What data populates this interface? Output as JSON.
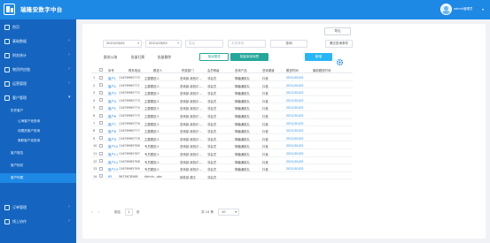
{
  "header": {
    "title": "瑞隆安数字中台",
    "username": "admin管理员",
    "brand_color": "#1e88e5",
    "avatar_icon": "user-avatar-icon",
    "caret_glyph": "▾"
  },
  "sidebar": {
    "background": "#1565c0",
    "items": [
      {
        "label": "首页",
        "icon": "home-icon"
      },
      {
        "label": "基础数据",
        "icon": "database-icon"
      },
      {
        "label": "财务统计",
        "icon": "finance-icon"
      },
      {
        "label": "物资供应链",
        "icon": "supply-chain-icon"
      },
      {
        "label": "运营管理",
        "icon": "operations-icon"
      },
      {
        "label": "客户管理",
        "icon": "customer-icon"
      }
    ],
    "sub_header": "历史客户",
    "sub_items": [
      {
        "label": "公海客户池查询"
      },
      {
        "label": "待跟进客户查询"
      },
      {
        "label": "离职客户池查询"
      }
    ],
    "more_items": [
      {
        "label": "客户报告"
      },
      {
        "label": "客户回访"
      },
      {
        "label": "客户列表",
        "active": true
      }
    ],
    "bottom_items": [
      {
        "label": "订单管理",
        "icon": "cart-icon"
      },
      {
        "label": "线上协作",
        "icon": "collab-icon"
      }
    ],
    "arrow_glyph": "›"
  },
  "toolbar": {
    "export_label": "导出",
    "date_from": "2021/03/02",
    "date_to": "2021/03/03",
    "name_placeholder": "姓名",
    "phone_placeholder": "手机号码",
    "query_label": "查询",
    "clear_label": "清空查询条件",
    "range_separator": "-",
    "caret_glyph": "▾"
  },
  "tabs": [
    {
      "label": "跟进公海"
    },
    {
      "label": "批量归属"
    },
    {
      "label": "批量删除"
    }
  ],
  "actions": {
    "assign_label": "指派跟进",
    "add_tag_label": "批量添加标签",
    "new_label": "新增",
    "settings_icon": "gear-icon"
  },
  "table": {
    "headers": [
      "序号",
      "姓名",
      "联系电话",
      "跟进人",
      "所属部门",
      "会员等级",
      "咨询产品",
      "咨询渠道",
      "跟进时间",
      "最新跟进时间"
    ],
    "rows": [
      {
        "index": "1",
        "name": "客户1",
        "phone": "11676965770",
        "owner": "主要跟进人",
        "dept": "咨询部-吴柏尔...",
        "level": "非会员",
        "product": "降糖通胶丸",
        "channel": "抖音",
        "date": "2021/01/02"
      },
      {
        "index": "2",
        "name": "客户2",
        "phone": "11676965771",
        "owner": "主要跟进人",
        "dept": "咨询部-吴柏尔...",
        "level": "非会员",
        "product": "降糖通胶丸",
        "channel": "抖音",
        "date": "2021/01/02"
      },
      {
        "index": "3",
        "name": "客户3",
        "phone": "11676965772",
        "owner": "主要跟进人",
        "dept": "咨询部-吴柏尔...",
        "level": "非会员",
        "product": "降糖通胶丸",
        "channel": "抖音",
        "date": "2021/01/02"
      },
      {
        "index": "4",
        "name": "客户4",
        "phone": "11676965773",
        "owner": "主要跟进人",
        "dept": "咨询部-吴柏尔...",
        "level": "非会员",
        "product": "降糖通胶丸",
        "channel": "抖音",
        "date": "2021/01/02"
      },
      {
        "index": "5",
        "name": "客户5",
        "phone": "11676965774",
        "owner": "主要跟进人",
        "dept": "咨询部-吴柏尔...",
        "level": "非会员",
        "product": "降糖通胶丸",
        "channel": "抖音",
        "date": "2021/01/02"
      },
      {
        "index": "6",
        "name": "客户6",
        "phone": "11676965775",
        "owner": "主要跟进人",
        "dept": "咨询部-吴柏尔...",
        "level": "非会员",
        "product": "降糖通胶丸",
        "channel": "抖音",
        "date": "2021/01/02"
      },
      {
        "index": "7",
        "name": "客户7",
        "phone": "11676965776",
        "owner": "主要跟进人",
        "dept": "咨询部-吴柏尔...",
        "level": "非会员",
        "product": "降糖通胶丸",
        "channel": "抖音",
        "date": "2021/01/02"
      },
      {
        "index": "8",
        "name": "客户8",
        "phone": "11676965777",
        "owner": "主要跟进人",
        "dept": "咨询部-吴柏尔...",
        "level": "非会员",
        "product": "降糖通胶丸",
        "channel": "抖音",
        "date": "2021/01/02"
      },
      {
        "index": "9",
        "name": "客户9",
        "phone": "11676965778",
        "owner": "主要跟进人",
        "dept": "咨询部-吴柏尔...",
        "level": "非会员",
        "product": "降糖通胶丸",
        "channel": "抖音",
        "date": "2021/01/02"
      },
      {
        "index": "10",
        "name": "客户10",
        "phone": "11676965766",
        "owner": "专员跟进人",
        "dept": "咨询部-吴柏尔...",
        "level": "非会员",
        "product": "降糖通胶丸",
        "channel": "抖音",
        "date": "2021/01/02"
      },
      {
        "index": "11",
        "name": "客户11",
        "phone": "11676965767",
        "owner": "专员跟进人",
        "dept": "咨询部-吴柏尔...",
        "level": "非会员",
        "product": "降糖通胶丸",
        "channel": "抖音",
        "date": "2021/01/02"
      },
      {
        "index": "12",
        "name": "客户12",
        "phone": "11676965768",
        "owner": "专员跟进人",
        "dept": "咨询部-吴柏尔...",
        "level": "非会员",
        "product": "降糖通胶丸",
        "channel": "抖音",
        "date": "2021/01/02"
      },
      {
        "index": "13",
        "name": "客户13",
        "phone": "11676965769",
        "owner": "专员跟进人",
        "dept": "咨询部-吴柏尔...",
        "level": "非会员",
        "product": "降糖通胶丸",
        "channel": "抖音",
        "date": "2021/01/02"
      },
      {
        "index": "14",
        "name": "65",
        "phone": "5675678568",
        "owner": "Admin...abc",
        "dept": "销售部-霸王",
        "level": "非会员",
        "product": "",
        "channel": "",
        "date": ""
      }
    ]
  },
  "pagination": {
    "prev_glyph": "‹",
    "next_glyph": "›",
    "goto_label": "前往",
    "page_value": "1",
    "page_suffix": "页",
    "total_label": "共 14 条",
    "size_value": "10"
  },
  "colors": {
    "accent_blue": "#1e88e5",
    "green": "#26a69a",
    "light_blue": "#29b6f6"
  }
}
